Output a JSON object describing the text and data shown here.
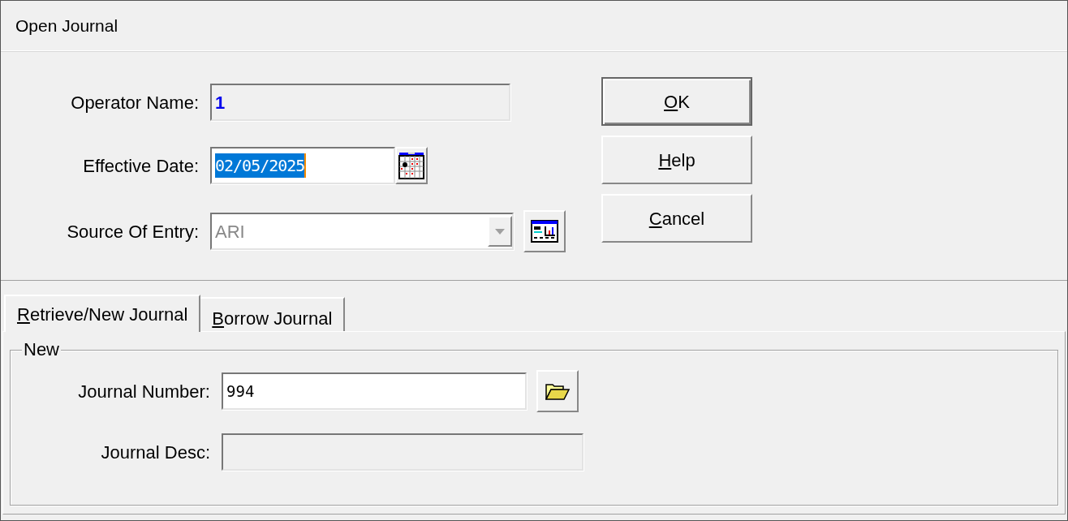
{
  "window": {
    "title": "Open Journal"
  },
  "fields": [
    {
      "kind": "text",
      "label": "Operator Name:",
      "value": "1",
      "disabled": true
    },
    {
      "kind": "date",
      "label": "Effective Date:",
      "value": "02/05/2025",
      "disabled": false,
      "selected": true
    },
    {
      "kind": "combo",
      "label": "Source Of Entry:",
      "value": "ARI",
      "disabled": true
    }
  ],
  "buttons": [
    {
      "access_key": "O",
      "label_rest": "K",
      "default": true
    },
    {
      "access_key": "H",
      "label_rest": "elp",
      "default": false
    },
    {
      "access_key": "C",
      "label_rest": "ancel",
      "default": false
    }
  ],
  "tabs": [
    {
      "access_key": "R",
      "label_rest": "etrieve/New Journal",
      "selected": true
    },
    {
      "access_key": "B",
      "label_rest": "orrow Journal",
      "selected": false
    }
  ],
  "group": {
    "title": "New",
    "fields": [
      {
        "kind": "browse",
        "label": "Journal Number:",
        "value": "994",
        "disabled": false
      },
      {
        "kind": "text",
        "label": "Journal Desc:",
        "disabled": true
      }
    ]
  }
}
